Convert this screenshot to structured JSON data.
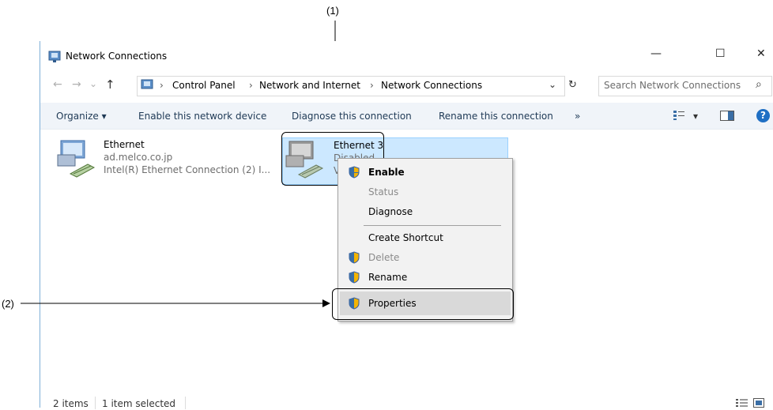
{
  "callouts": {
    "c1": "(1)",
    "c2": "(2)"
  },
  "window": {
    "title": "Network Connections",
    "controls": {
      "minimize": "—",
      "maximize": "☐",
      "close": "✕"
    }
  },
  "address": {
    "nav": {
      "back": "←",
      "forward": "→",
      "history": "⌄",
      "up": "↑"
    },
    "crumbs": [
      "Control Panel",
      "Network and Internet",
      "Network Connections"
    ],
    "sep": "›",
    "dropdown": "⌄",
    "refresh": "↻",
    "search_placeholder": "Search Network Connections",
    "search_glyph": "⌕"
  },
  "toolbar": {
    "organize": "Organize ▾",
    "enable": "Enable this network device",
    "diagnose": "Diagnose this connection",
    "rename": "Rename this connection",
    "more": "»",
    "view_arrow": "▾",
    "help": "?"
  },
  "items": [
    {
      "name": "Ethernet",
      "line2": "ad.melco.co.jp",
      "line3": "Intel(R) Ethernet Connection (2) I..."
    },
    {
      "name": "Ethernet 3",
      "line2": "Disabled",
      "line3": "V"
    }
  ],
  "context_menu": {
    "enable": "Enable",
    "status": "Status",
    "diagnose": "Diagnose",
    "create_shortcut": "Create Shortcut",
    "delete": "Delete",
    "rename": "Rename",
    "properties": "Properties"
  },
  "statusbar": {
    "count": "2 items",
    "selected": "1 item selected"
  },
  "colors": {
    "accent": "#cce8ff",
    "selection_border": "#99d1ff",
    "help": "#1f6fc4"
  }
}
